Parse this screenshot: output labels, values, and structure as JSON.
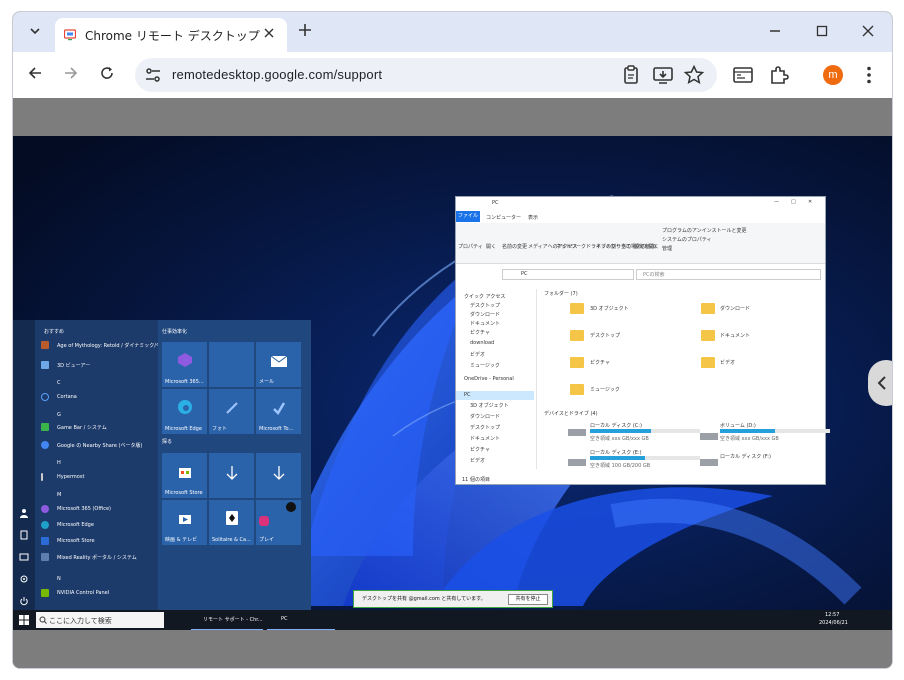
{
  "browser": {
    "tab_title": "Chrome リモート デスクトップ",
    "url": "remotedesktop.google.com/support",
    "profile_initial": "m"
  },
  "remote": {
    "start_menu": {
      "recent_header": "おすすめ",
      "pinned_header": "仕事効率化",
      "group2_header": "探る",
      "apps": [
        {
          "label": "Age of Mythology: Retold / ダイナミック/今すぐ入手"
        },
        {
          "label": "3D ビューアー"
        },
        {
          "label": "C"
        },
        {
          "label": "Cortana"
        },
        {
          "label": "G"
        },
        {
          "label": "Game Bar / システム"
        },
        {
          "label": "Google の Nearby Share (ベータ版)"
        },
        {
          "label": "H"
        },
        {
          "label": "Hypermost"
        },
        {
          "label": "M"
        },
        {
          "label": "Microsoft 365 (Office)"
        },
        {
          "label": "Microsoft Edge"
        },
        {
          "label": "Microsoft Store"
        },
        {
          "label": "Mixed Reality ポータル / システム"
        },
        {
          "label": "N"
        },
        {
          "label": "NVIDIA Control Panel"
        }
      ],
      "tiles": [
        {
          "label": "Microsoft 365..."
        },
        {
          "label": ""
        },
        {
          "label": "メール"
        },
        {
          "label": "Microsoft Edge"
        },
        {
          "label": "フォト"
        },
        {
          "label": "Microsoft To..."
        },
        {
          "label": "Microsoft Store"
        },
        {
          "label": ""
        },
        {
          "label": ""
        },
        {
          "label": "映画 & テレビ"
        },
        {
          "label": "Solitaire & Ca..."
        },
        {
          "label": "プレイ"
        }
      ]
    },
    "explorer": {
      "title": "PC",
      "tabs": [
        "ファイル",
        "コンピューター",
        "表示"
      ],
      "ribbon": [
        "プロパティ",
        "開く",
        "名前の変更",
        "メディアへのアクセス",
        "ネットワークドライブの割り当て",
        "ネットワークの場所の追加",
        "設定を開く"
      ],
      "ribbon_right": [
        "プログラムのアンインストールと変更",
        "システムのプロパティ",
        "管理"
      ],
      "address": "PC",
      "search_placeholder": "PCの検索",
      "nav": [
        "クイック アクセス",
        "デスクトップ",
        "ダウンロード",
        "ドキュメント",
        "ピクチャ",
        "download",
        "ビデオ",
        "ミュージック",
        "OneDrive - Personal",
        "PC",
        "3D オブジェクト",
        "ダウンロード",
        "デスクトップ",
        "ドキュメント",
        "ピクチャ",
        "ビデオ"
      ],
      "folders_header": "フォルダー (7)",
      "folders": [
        "3D オブジェクト",
        "ダウンロード",
        "デスクトップ",
        "ドキュメント",
        "ピクチャ",
        "ビデオ",
        "ミュージック"
      ],
      "drives_header": "デバイスとドライブ (4)",
      "drives": [
        {
          "name": "ローカル ディスク (C:)",
          "detail": "空き領域 xxx GB/xxx GB",
          "used": 0.55
        },
        {
          "name": "ボリューム (D:)",
          "detail": "空き領域 xxx GB/xxx GB",
          "used": 0.5
        },
        {
          "name": "ローカル ディスク (E:)",
          "detail": "空き領域 100 GB/200 GB",
          "used": 0.5
        },
        {
          "name": "ローカル ディスク (F:)",
          "detail": "",
          "used": 0
        }
      ],
      "status": "11 個の項目"
    },
    "taskbar": {
      "search_placeholder": "ここに入力して検索",
      "items": [
        "リモート サポート - Chr...",
        "PC"
      ],
      "time": "12:57",
      "date": "2024/06/21"
    },
    "notification": {
      "text": "デスクトップを共有 @gmail.com と共有しています。",
      "button": "共有を停止"
    }
  }
}
